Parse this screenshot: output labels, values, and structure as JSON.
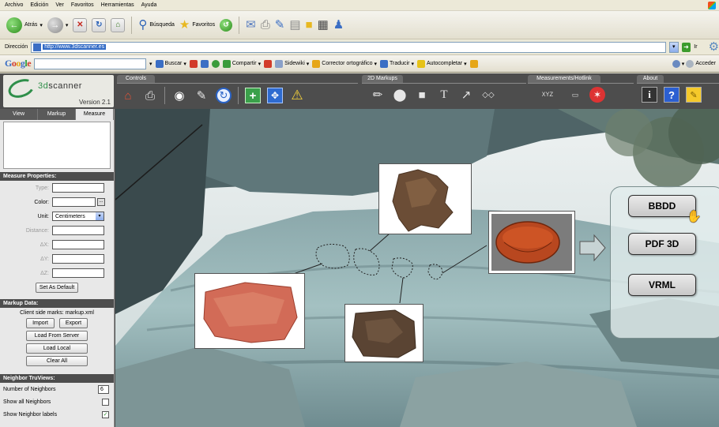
{
  "browser": {
    "menu": [
      "Archivo",
      "Edición",
      "Ver",
      "Favoritos",
      "Herramientas",
      "Ayuda"
    ],
    "toolbar": {
      "back": "Atrás",
      "search": "Búsqueda",
      "favorites": "Favoritos"
    },
    "address": {
      "label": "Dirección",
      "url": "http://www.3dscanner.es",
      "go": "Ir"
    },
    "googlebar": {
      "search": "Buscar",
      "share": "Compartir",
      "sidewiki": "Sidewiki",
      "spell": "Corrector ortográfico",
      "translate": "Traducir",
      "autofill": "Autocompletar",
      "signin": "Acceder"
    }
  },
  "app": {
    "logo": {
      "name_a": "3d",
      "name_b": "scanner",
      "version": "Version 2.1"
    },
    "sections": {
      "controls": "Controls",
      "markups": "2D Markups",
      "measurements": "Measurements/Hotlink",
      "about": "About"
    },
    "tabs": [
      "View",
      "Markup",
      "Measure"
    ],
    "measure_properties": {
      "title": "Measure Properties:",
      "type_label": "Type:",
      "color_label": "Color:",
      "unit_label": "Unit:",
      "unit_value": "Centimeters",
      "distance_label": "Distance:",
      "dx_label": "ΔX:",
      "dy_label": "ΔY:",
      "dz_label": "ΔZ:",
      "set_default": "Set As Default"
    },
    "markup_data": {
      "title": "Markup Data:",
      "caption": "Client side marks: markup.xml",
      "import": "Import",
      "export": "Export",
      "load_server": "Load From Server",
      "load_local": "Load Local",
      "clear_all": "Clear All"
    },
    "neighbor": {
      "title": "Neighbor TruViews:",
      "count_label": "Number of Neighbors",
      "count_value": "6",
      "show_all": "Show all Neighbors",
      "show_labels": "Show Neighbor labels"
    },
    "export_buttons": [
      "BBDD",
      "PDF 3D",
      "VRML"
    ]
  }
}
